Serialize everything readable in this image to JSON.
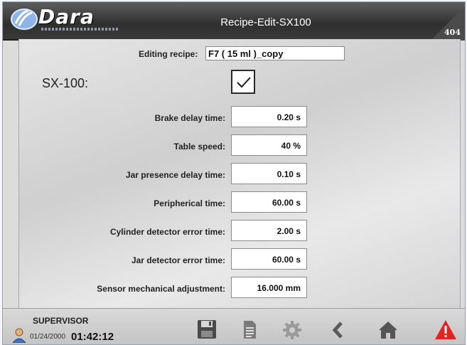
{
  "header": {
    "brand": "Dara",
    "title": "Recipe-Edit-SX100",
    "screen_number": "404"
  },
  "editing": {
    "label": "Editing recipe:",
    "value": "F7 ( 15 ml )_copy"
  },
  "model": {
    "label": "SX-100:",
    "enabled": true
  },
  "parameters": [
    {
      "label": "Brake delay time:",
      "value": "0.20 s"
    },
    {
      "label": "Table speed:",
      "value": "40 %"
    },
    {
      "label": "Jar presence delay time:",
      "value": "0.10 s"
    },
    {
      "label": "Peripherical time:",
      "value": "60.00 s"
    },
    {
      "label": "Cylinder detector error time:",
      "value": "2.00 s"
    },
    {
      "label": "Jar detector error time:",
      "value": "60.00 s"
    },
    {
      "label": "Sensor mechanical adjustment:",
      "value": "16.000 mm"
    }
  ],
  "footer": {
    "user": "SUPERVISOR",
    "date": "01/24/2000",
    "time": "01:42:12",
    "buttons": [
      "save-icon",
      "document-icon",
      "gear-icon",
      "back-icon",
      "home-icon",
      "alarm-icon"
    ]
  },
  "colors": {
    "header_bg": "#3a3a3a",
    "alarm": "#e52222"
  }
}
